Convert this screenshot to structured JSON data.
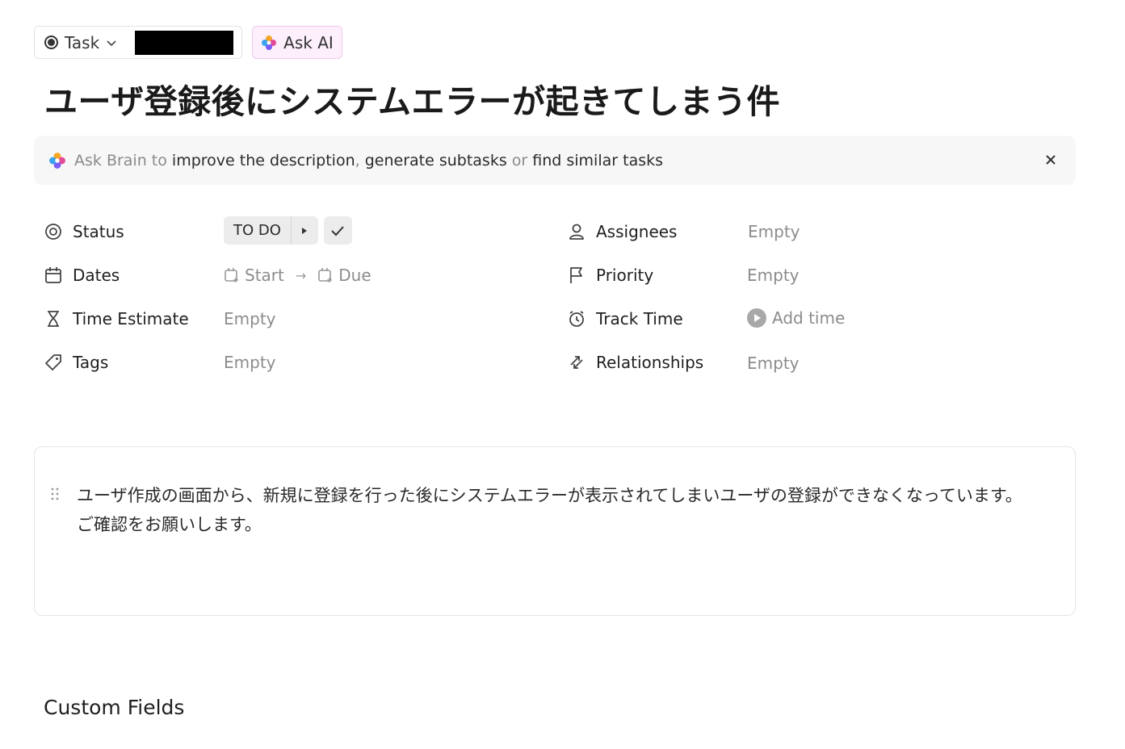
{
  "toolbar": {
    "task_type_label": "Task",
    "ask_ai_label": "Ask AI"
  },
  "task": {
    "title": "ユーザ登録後にシステムエラーが起きてしまう件"
  },
  "banner": {
    "prefix": "Ask Brain to",
    "action1": "improve the description",
    "sep1": ",",
    "action2": "generate subtasks",
    "sep2": "or",
    "action3": "find similar tasks"
  },
  "properties": {
    "status": {
      "label": "Status",
      "value": "TO DO"
    },
    "dates": {
      "label": "Dates",
      "start": "Start",
      "due": "Due"
    },
    "time_estimate": {
      "label": "Time Estimate",
      "value": "Empty"
    },
    "tags": {
      "label": "Tags",
      "value": "Empty"
    },
    "assignees": {
      "label": "Assignees",
      "value": "Empty"
    },
    "priority": {
      "label": "Priority",
      "value": "Empty"
    },
    "track_time": {
      "label": "Track Time",
      "value": "Add time"
    },
    "relationships": {
      "label": "Relationships",
      "value": "Empty"
    }
  },
  "description": {
    "text": "ユーザ作成の画面から、新規に登録を行った後にシステムエラーが表示されてしまいユーザの登録ができなくなっています。ご確認をお願いします。"
  },
  "sections": {
    "custom_fields_title": "Custom Fields"
  },
  "colors": {
    "ask_ai_bg": "#fdf0fc",
    "banner_bg": "#f7f7f7",
    "status_pill_bg": "#ececec"
  }
}
